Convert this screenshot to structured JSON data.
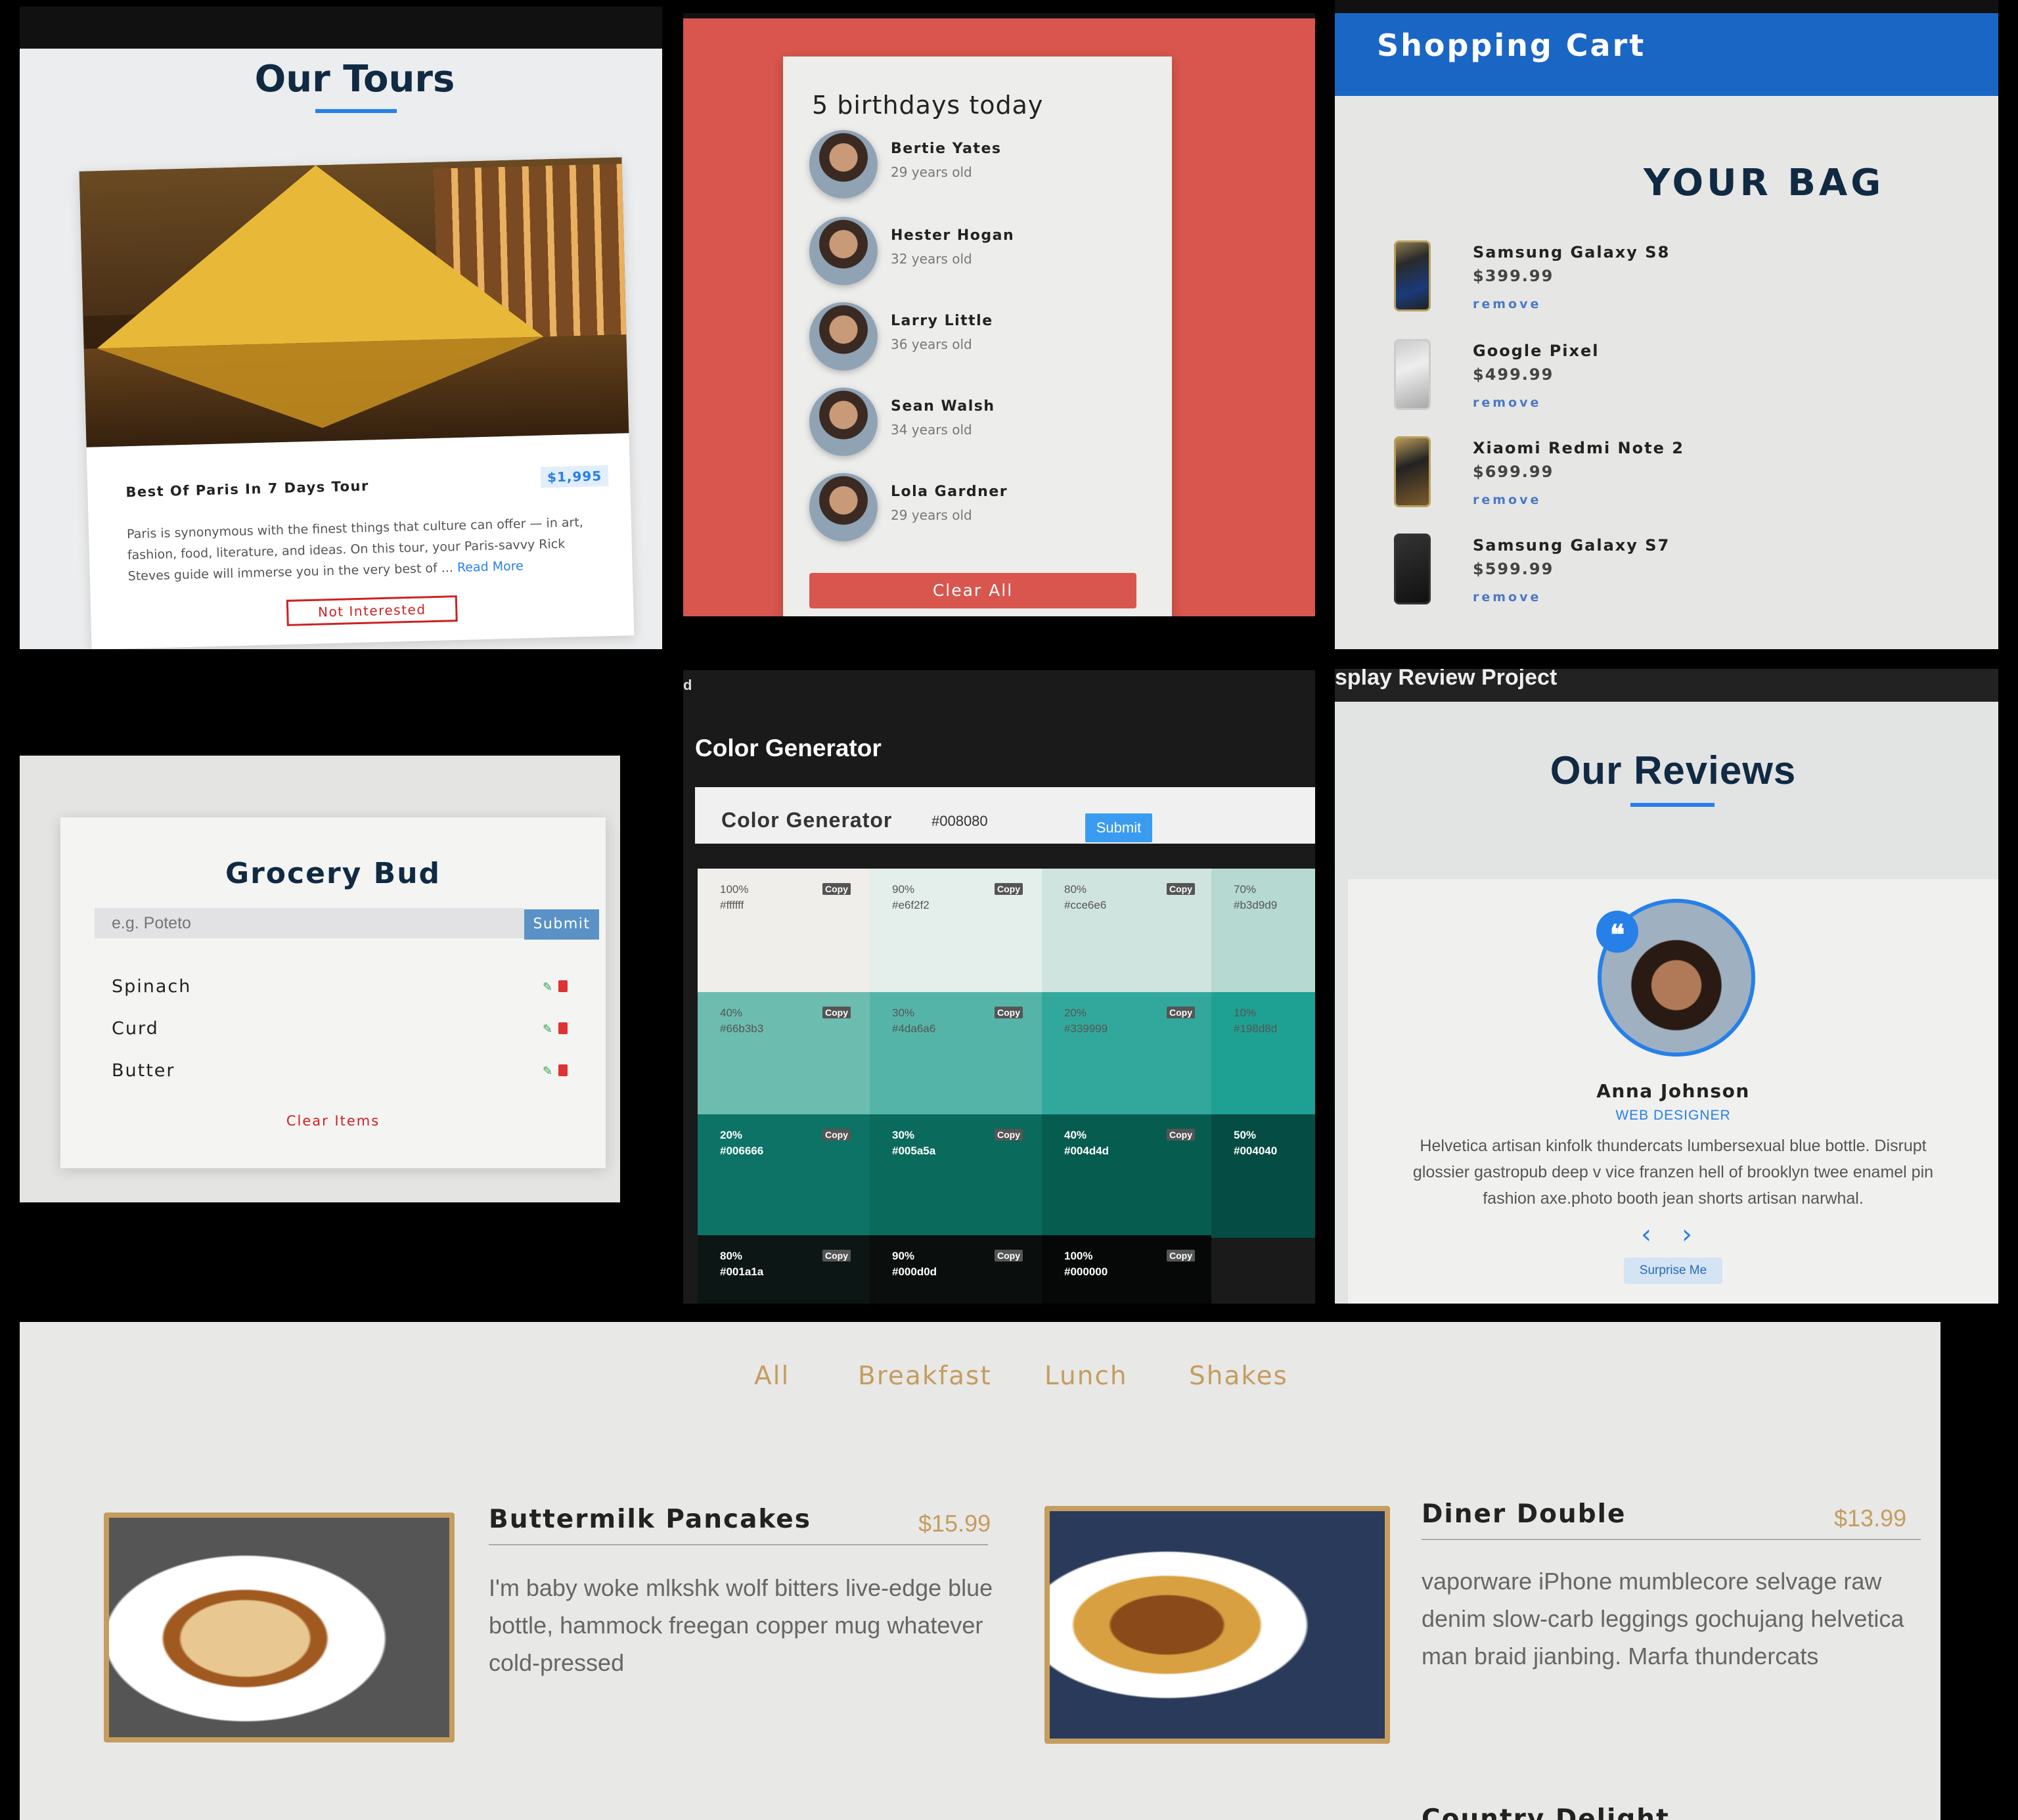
{
  "tours": {
    "title": "Our Tours",
    "tour": {
      "name": "Best Of Paris In 7 Days Tour",
      "price": "$1,995",
      "description": "Paris is synonymous with the finest things that culture can offer — in art, fashion, food, literature, and ideas. On this tour, your Paris-savvy Rick Steves guide will immerse you in the very best of ...",
      "read_more": "Read More",
      "button": "Not Interested"
    }
  },
  "birthdays": {
    "title": "5 birthdays today",
    "people": [
      {
        "name": "Bertie Yates",
        "age": "29 years old"
      },
      {
        "name": "Hester Hogan",
        "age": "32 years old"
      },
      {
        "name": "Larry Little",
        "age": "36 years old"
      },
      {
        "name": "Sean Walsh",
        "age": "34 years old"
      },
      {
        "name": "Lola Gardner",
        "age": "29 years old"
      }
    ],
    "button": "Clear All"
  },
  "cart": {
    "brand": "Shopping Cart",
    "heading": "YOUR BAG",
    "items": [
      {
        "name": "Samsung Galaxy S8",
        "price": "$399.99",
        "remove": "remove"
      },
      {
        "name": "Google Pixel",
        "price": "$499.99",
        "remove": "remove"
      },
      {
        "name": "Xiaomi Redmi Note 2",
        "price": "$699.99",
        "remove": "remove"
      },
      {
        "name": "Samsung Galaxy S7",
        "price": "$599.99",
        "remove": "remove"
      }
    ]
  },
  "grocery": {
    "title": "Grocery Bud",
    "placeholder": "e.g. Poteto",
    "submit": "Submit",
    "items": [
      "Spinach",
      "Curd",
      "Butter"
    ],
    "clear": "Clear Items"
  },
  "color_gen": {
    "fragment": "d",
    "header": "Color Generator",
    "title": "Color Generator",
    "input_value": "#008080",
    "submit": "Submit",
    "copy_label": "Copy",
    "swatches": [
      {
        "pct": "100%",
        "hex": "#ffffff",
        "bg": "#f0eeea",
        "tone": "lt"
      },
      {
        "pct": "90%",
        "hex": "#e6f2f2",
        "bg": "#e4efeb",
        "tone": "lt"
      },
      {
        "pct": "80%",
        "hex": "#cce6e6",
        "bg": "#cfe4df",
        "tone": "lt"
      },
      {
        "pct": "70%",
        "hex": "#b3d9d9",
        "bg": "#b6d9d2",
        "tone": "lt"
      },
      {
        "pct": "40%",
        "hex": "#66b3b3",
        "bg": "#6cbcb0",
        "tone": "lt"
      },
      {
        "pct": "30%",
        "hex": "#4da6a6",
        "bg": "#55b4a8",
        "tone": "lt"
      },
      {
        "pct": "20%",
        "hex": "#339999",
        "bg": "#32a89c",
        "tone": "lt"
      },
      {
        "pct": "10%",
        "hex": "#198d8d",
        "bg": "#1ea092",
        "tone": "lt"
      },
      {
        "pct": "20%",
        "hex": "#006666",
        "bg": "#0c7366",
        "tone": "dk"
      },
      {
        "pct": "30%",
        "hex": "#005a5a",
        "bg": "#0a6a5c",
        "tone": "dk"
      },
      {
        "pct": "40%",
        "hex": "#004d4d",
        "bg": "#075c50",
        "tone": "dk"
      },
      {
        "pct": "50%",
        "hex": "#004040",
        "bg": "#054c44",
        "tone": "dk"
      },
      {
        "pct": "80%",
        "hex": "#001a1a",
        "bg": "#0c1614",
        "tone": "dk"
      },
      {
        "pct": "90%",
        "hex": "#000d0d",
        "bg": "#0a0f0e",
        "tone": "dk"
      },
      {
        "pct": "100%",
        "hex": "#000000",
        "bg": "#060808",
        "tone": "dk"
      }
    ]
  },
  "reviews": {
    "fragment": "splay Review Project",
    "title": "Our Reviews",
    "person": {
      "name": "Anna Johnson",
      "job": "WEB DESIGNER",
      "text": "Helvetica artisan kinfolk thundercats lumbersexual blue bottle. Disrupt glossier gastropub deep v vice franzen hell of brooklyn twee enamel pin fashion axe.photo booth jean shorts artisan narwhal."
    },
    "prev_icon": "chevron-left-icon",
    "next_icon": "chevron-right-icon",
    "button": "Surprise Me"
  },
  "menu": {
    "tabs": [
      "All",
      "Breakfast",
      "Lunch",
      "Shakes"
    ],
    "items": [
      {
        "name": "Buttermilk Pancakes",
        "price": "$15.99",
        "desc": "I'm baby woke mlkshk wolf bitters live-edge blue bottle, hammock freegan copper mug whatever cold-pressed"
      },
      {
        "name": "Diner Double",
        "price": "$13.99",
        "desc": "vaporware iPhone mumblecore selvage raw denim slow-carb leggings gochujang helvetica man braid jianbing. Marfa thundercats"
      }
    ],
    "next_partial": "Country Delight"
  },
  "colors": {
    "accent_blue": "#2680e8",
    "bday_red": "#d8564e",
    "cart_blue": "#1a66c4",
    "menu_gold": "#c59d5f",
    "danger_red": "#cc2222"
  }
}
